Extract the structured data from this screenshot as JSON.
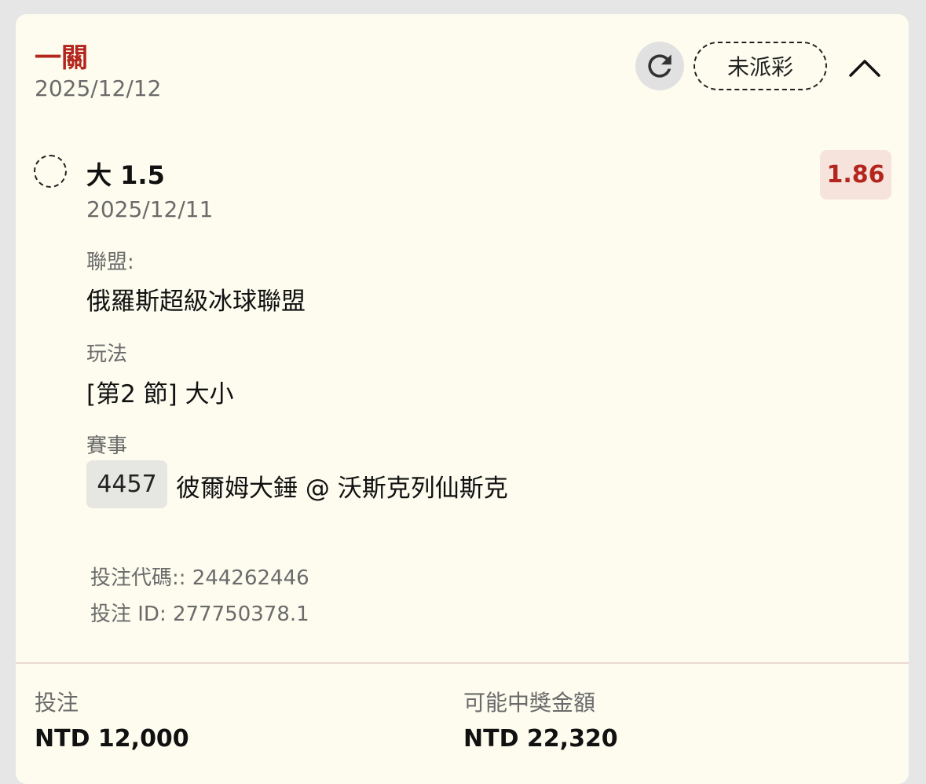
{
  "header": {
    "bet_type": "一關",
    "date": "2025/12/12",
    "refresh_icon": "refresh-icon",
    "status": "未派彩",
    "collapse_icon": "chevron-up-icon"
  },
  "selection": {
    "status_icon": "pending-dashed-circle-icon",
    "pick": "大 1.5",
    "date": "2025/12/11",
    "odds": "1.86"
  },
  "details": {
    "league_label": "聯盟:",
    "league_value": "俄羅斯超級冰球聯盟",
    "market_label": "玩法",
    "market_value": "[第2 節] 大小",
    "event_label": "賽事",
    "event_id": "4457",
    "event_name": "彼爾姆大錘 @ 沃斯克列仙斯克"
  },
  "meta": {
    "bet_code": "投注代碼:: 244262446",
    "bet_id": "投注 ID: 277750378.1"
  },
  "footer": {
    "stake_label": "投注",
    "stake_value": "NTD 12,000",
    "payout_label": "可能中獎金額",
    "payout_value": "NTD 22,320"
  },
  "colors": {
    "card_bg": "#fdfcef",
    "accent_red": "#b3261e",
    "odds_bg": "#f5e3dc",
    "page_bg": "#e6e6e6"
  }
}
